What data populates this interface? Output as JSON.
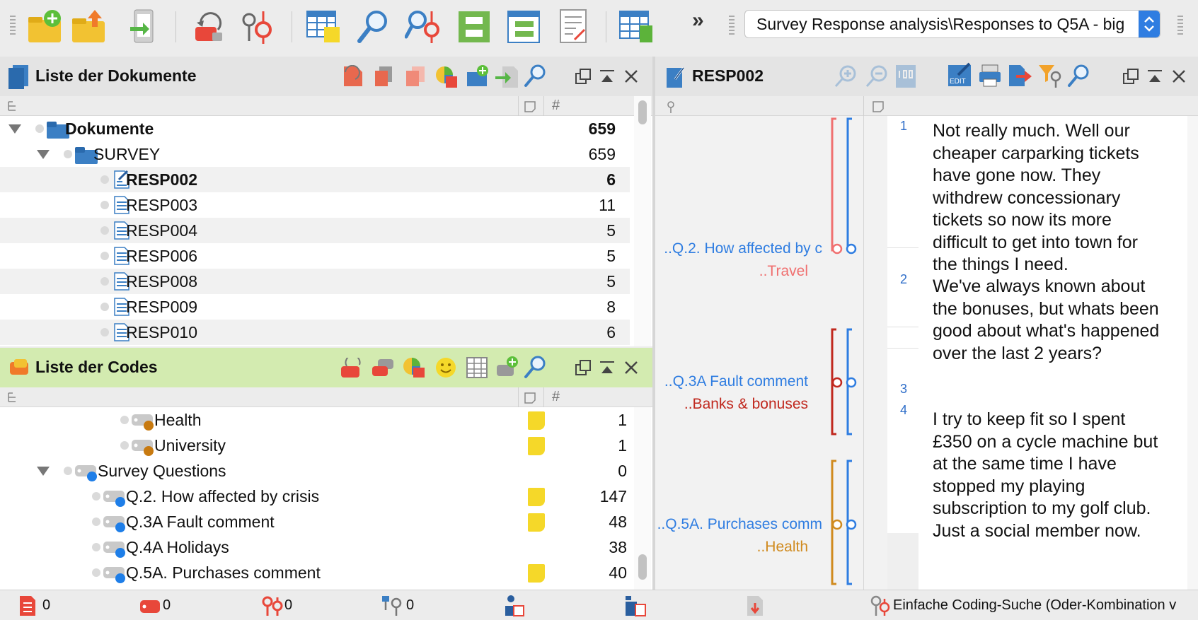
{
  "toolbar": {
    "icons": [
      "new-project-icon",
      "open-project-icon",
      "import-icon",
      "code-undo-icon",
      "retrieval-icon",
      "table-icon",
      "search-icon",
      "coding-query-icon",
      "document-portrait-icon",
      "code-matrix-icon",
      "summary-icon",
      "variables-icon"
    ],
    "overflow_label": "»",
    "project_path": "Survey Response analysis\\Responses to Q5A - big"
  },
  "documents_panel": {
    "title": "Liste der Dokumente",
    "rows": [
      {
        "label": "Dokumente",
        "count": "659"
      },
      {
        "label": "SURVEY",
        "count": "659"
      },
      {
        "label": "RESP002",
        "count": "6"
      },
      {
        "label": "RESP003",
        "count": "11"
      },
      {
        "label": "RESP004",
        "count": "5"
      },
      {
        "label": "RESP006",
        "count": "5"
      },
      {
        "label": "RESP008",
        "count": "5"
      },
      {
        "label": "RESP009",
        "count": "8"
      },
      {
        "label": "RESP010",
        "count": "6"
      }
    ]
  },
  "codes_panel": {
    "title": "Liste der Codes",
    "rows": [
      {
        "label": "Health",
        "count": "1"
      },
      {
        "label": "University",
        "count": "1"
      },
      {
        "label": "Survey Questions",
        "count": "0"
      },
      {
        "label": "Q.2. How affected by crisis",
        "count": "147"
      },
      {
        "label": "Q.3A Fault comment",
        "count": "48"
      },
      {
        "label": "Q.4A Holidays",
        "count": "38"
      },
      {
        "label": "Q.5A. Purchases comment",
        "count": "40"
      }
    ]
  },
  "document_browser": {
    "title": "RESP002",
    "segments": [
      {
        "code": "..Q.2. How affected by c",
        "sub": "..Travel"
      },
      {
        "code": "..Q.3A Fault comment",
        "sub": "..Banks & bonuses"
      },
      {
        "code": "..Q.5A. Purchases comm",
        "sub": "..Health"
      }
    ],
    "paragraphs": [
      {
        "num": "1",
        "text": "Not really much. Well our cheaper carparking tickets have gone now. They withdrew concessionary tickets so now its more difficult to get into town for the things I need."
      },
      {
        "num": "2",
        "text": "We've always known about the bonuses, but whats been good about what's happened over the last 2 years?"
      },
      {
        "num": "3",
        "text": ""
      },
      {
        "num": "4",
        "text": "I try to keep fit so I spent £350 on a cycle machine but at the same time I have stopped my playing subscription to my golf club. Just a social member now."
      }
    ]
  },
  "statusbar": {
    "docs_count": "0",
    "codes_count": "0",
    "coded_segments_count": "0",
    "variables_count": "0",
    "search_mode": "Einfache Coding-Suche (Oder-Kombination v"
  },
  "colors": {
    "accent_blue": "#2f7de1",
    "travel_red": "#f07070",
    "banks_red": "#c0281e",
    "health_orange": "#d08a1e",
    "code_list_header": "#d3ebb0"
  }
}
